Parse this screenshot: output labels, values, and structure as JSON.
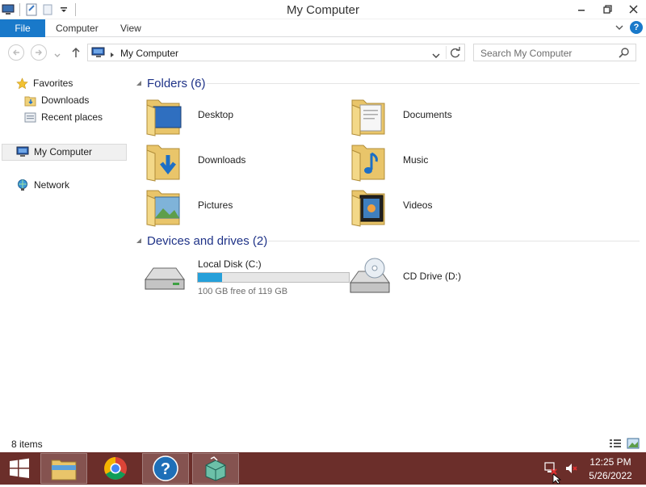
{
  "window": {
    "title": "My Computer"
  },
  "ribbon": {
    "tabs": [
      {
        "label": "File"
      },
      {
        "label": "Computer"
      },
      {
        "label": "View"
      }
    ],
    "help_label": "?"
  },
  "address": {
    "path": "My Computer",
    "search_placeholder": "Search My Computer"
  },
  "nav": {
    "favorites": "Favorites",
    "downloads": "Downloads",
    "recent": "Recent places",
    "computer": "My Computer",
    "network": "Network"
  },
  "folders": {
    "header": "Folders (6)",
    "items": [
      {
        "label": "Desktop",
        "icon": "desktop-folder-icon"
      },
      {
        "label": "Documents",
        "icon": "documents-folder-icon"
      },
      {
        "label": "Downloads",
        "icon": "downloads-folder-icon"
      },
      {
        "label": "Music",
        "icon": "music-folder-icon"
      },
      {
        "label": "Pictures",
        "icon": "pictures-folder-icon"
      },
      {
        "label": "Videos",
        "icon": "videos-folder-icon"
      }
    ]
  },
  "drives": {
    "header": "Devices and drives (2)",
    "items": [
      {
        "label": "Local Disk (C:)",
        "free": "100 GB free of 119 GB",
        "used_fraction": 0.16
      },
      {
        "label": "CD Drive (D:)"
      }
    ]
  },
  "status": {
    "items": "8 items"
  },
  "taskbar": {
    "time": "12:25 PM",
    "date": "5/26/2022"
  },
  "colors": {
    "accent": "#1979ca",
    "taskbar": "#6b2e2a",
    "drive_fill": "#26a0da",
    "group_header": "#1e3287"
  }
}
